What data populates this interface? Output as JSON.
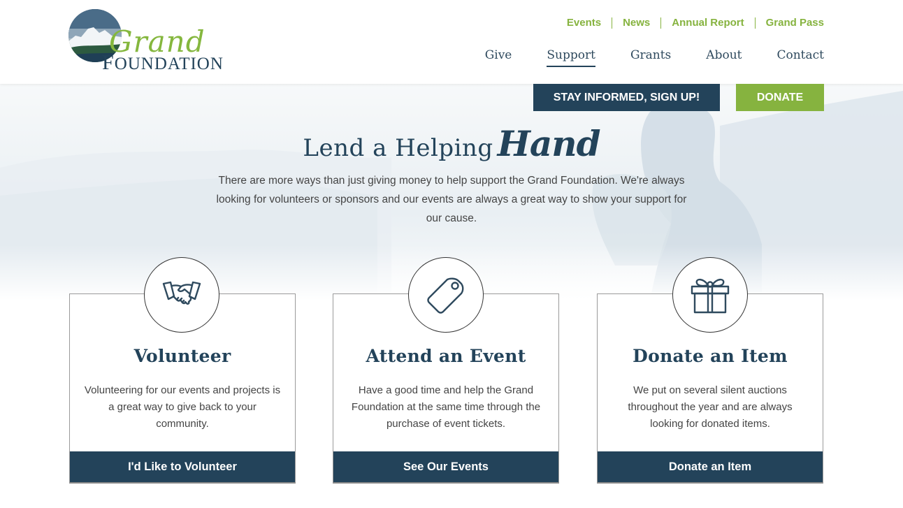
{
  "brand": {
    "logo_script": "Grand",
    "logo_caps_first": "F",
    "logo_caps_rest": "OUNDATION",
    "logo_alt": "Grand Foundation",
    "colors": {
      "navy": "#23435a",
      "green": "#86b33f"
    }
  },
  "utility_nav": [
    {
      "label": "Events"
    },
    {
      "label": "News"
    },
    {
      "label": "Annual Report"
    },
    {
      "label": "Grand Pass"
    }
  ],
  "main_nav": [
    {
      "label": "Give",
      "active": false
    },
    {
      "label": "Support",
      "active": true
    },
    {
      "label": "Grants",
      "active": false
    },
    {
      "label": "About",
      "active": false
    },
    {
      "label": "Contact",
      "active": false
    }
  ],
  "cta": {
    "signup_label": "STAY INFORMED, SIGN UP!",
    "donate_label": "DONATE"
  },
  "hero": {
    "title_plain": "Lend a Helping",
    "title_script": "Hand",
    "text": "There are more ways than just giving money to help support the Grand Foundation. We're always looking for volunteers or sponsors and our events are always a great way to show your support for our cause."
  },
  "cards": [
    {
      "icon": "handshake-icon",
      "title": "Volunteer",
      "text": "Volunteering for our events and projects is a great way to give back to your community.",
      "button": "I'd Like to Volunteer"
    },
    {
      "icon": "tag-icon",
      "title": "Attend an Event",
      "text": "Have a good time and help the Grand Foundation at the same time through the purchase of event tickets.",
      "button": "See Our Events"
    },
    {
      "icon": "gift-icon",
      "title": "Donate an Item",
      "text": "We put on several silent auctions throughout the year and are always looking for donated items.",
      "button": "Donate an Item"
    }
  ]
}
